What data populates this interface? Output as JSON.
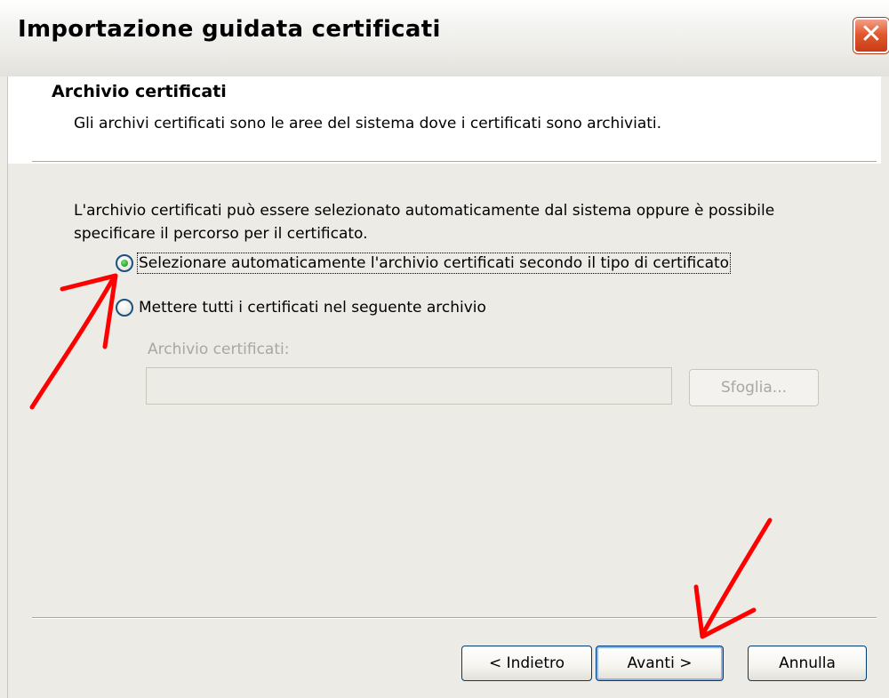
{
  "window": {
    "title": "Importazione guidata certificati",
    "close_icon": "close-icon"
  },
  "header": {
    "title": "Archivio certificati",
    "subtitle": "Gli archivi certificati sono le aree del sistema dove i certificati sono archiviati."
  },
  "main": {
    "description": "L'archivio certificati può essere selezionato automaticamente dal sistema oppure è possibile specificare il percorso per il certificato.",
    "options": [
      {
        "label": "Selezionare automaticamente l'archivio certificati secondo il tipo di certificato",
        "selected": true
      },
      {
        "label": "Mettere tutti i certificati nel seguente archivio",
        "selected": false
      }
    ],
    "store_label": "Archivio certificati:",
    "store_value": "",
    "browse_label": "Sfoglia..."
  },
  "footer": {
    "back_label": "< Indietro",
    "next_label": "Avanti >",
    "cancel_label": "Annulla"
  },
  "annotations": {
    "arrow_color": "#ff0000"
  }
}
